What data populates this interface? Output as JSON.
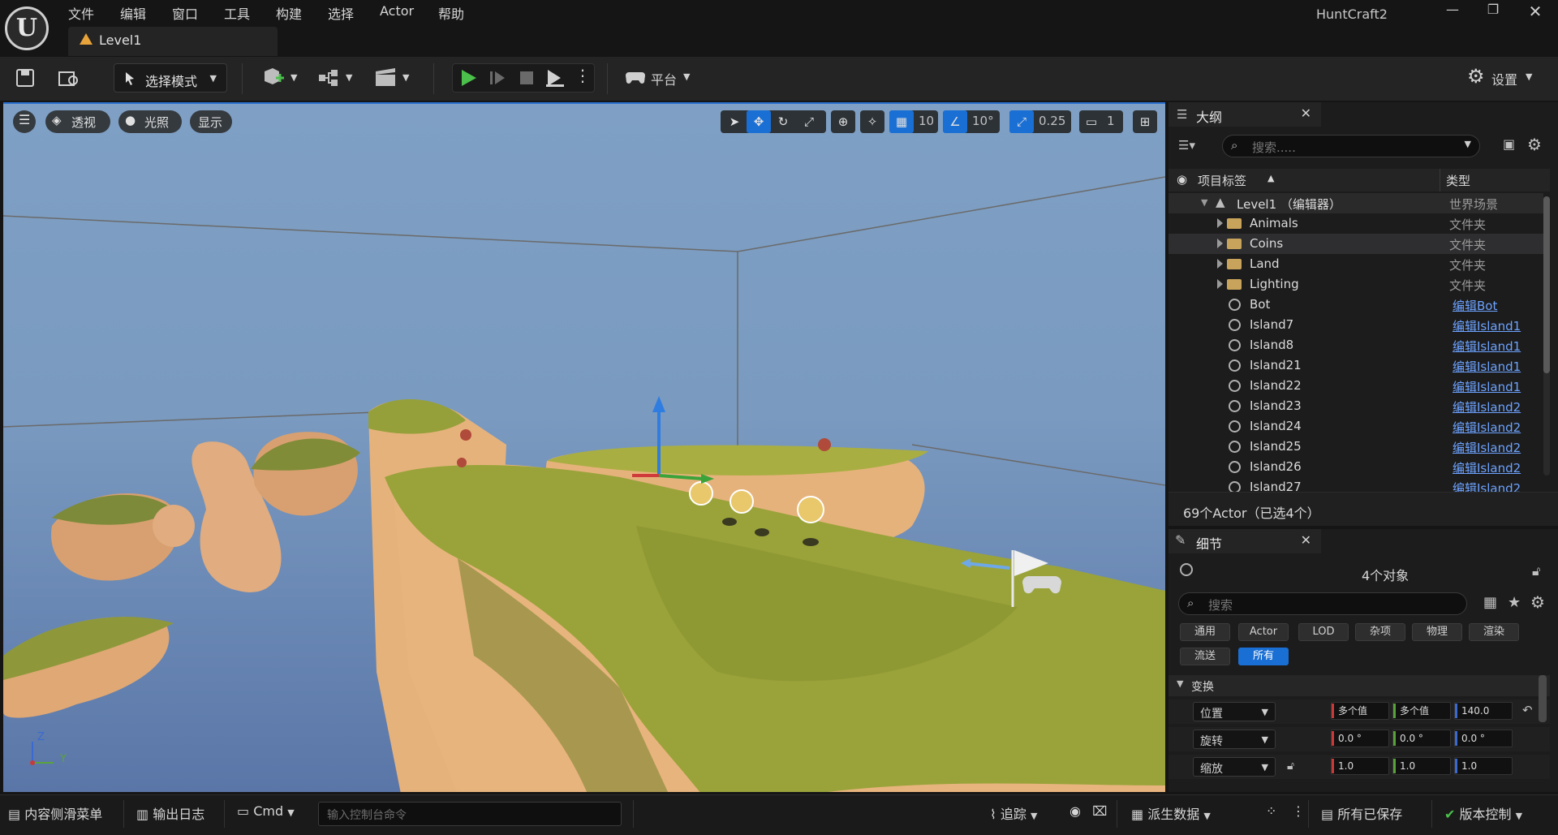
{
  "app": {
    "title": "HuntCraft2",
    "menu": [
      "文件",
      "编辑",
      "窗口",
      "工具",
      "构建",
      "选择",
      "Actor",
      "帮助"
    ],
    "level_tab": "Level1"
  },
  "toolbar": {
    "mode_select": "选择模式",
    "platform": "平台",
    "settings": "设置"
  },
  "viewport": {
    "perspective": "透视",
    "lighting": "光照",
    "show": "显示",
    "grid_snap": "10",
    "rot_snap": "10°",
    "scale_snap": "0.25",
    "camera_speed": "1",
    "axis_z": "Z",
    "axis_y": "Y"
  },
  "outliner": {
    "tab": "大纲",
    "search_placeholder": "搜索.....",
    "col_label": "项目标签",
    "col_type": "类型",
    "root": {
      "name": "Level1 （编辑器）",
      "type": "世界场景"
    },
    "folders": [
      {
        "name": "Animals",
        "type": "文件夹"
      },
      {
        "name": "Coins",
        "type": "文件夹"
      },
      {
        "name": "Land",
        "type": "文件夹"
      },
      {
        "name": "Lighting",
        "type": "文件夹"
      }
    ],
    "actors": [
      {
        "name": "Bot",
        "type": "编辑Bot"
      },
      {
        "name": "Island7",
        "type": "编辑Island1"
      },
      {
        "name": "Island8",
        "type": "编辑Island1"
      },
      {
        "name": "Island21",
        "type": "编辑Island1"
      },
      {
        "name": "Island22",
        "type": "编辑Island1"
      },
      {
        "name": "Island23",
        "type": "编辑Island2"
      },
      {
        "name": "Island24",
        "type": "编辑Island2"
      },
      {
        "name": "Island25",
        "type": "编辑Island2"
      },
      {
        "name": "Island26",
        "type": "编辑Island2"
      },
      {
        "name": "Island27",
        "type": "编辑Island2"
      }
    ],
    "status": "69个Actor（已选4个）"
  },
  "details": {
    "tab": "细节",
    "objects": "4个对象",
    "search_placeholder": "搜索",
    "filters": [
      "通用",
      "Actor",
      "LOD",
      "杂项",
      "物理",
      "渲染",
      "流送",
      "所有"
    ],
    "section": "变换",
    "location": {
      "label": "位置",
      "x": "多个值",
      "y": "多个值",
      "z": "140.0"
    },
    "rotation": {
      "label": "旋转",
      "x": "0.0 °",
      "y": "0.0 °",
      "z": "0.0 °"
    },
    "scale": {
      "label": "缩放",
      "x": "1.0",
      "y": "1.0",
      "z": "1.0"
    }
  },
  "statusbar": {
    "content_drawer": "内容侧滑菜单",
    "output_log": "输出日志",
    "cmd": "Cmd",
    "cmd_placeholder": "输入控制台命令",
    "trace": "追踪",
    "derived_data": "派生数据",
    "all_saved": "所有已保存",
    "source_control": "版本控制"
  },
  "colors": {
    "accent": "#1a6fd4",
    "link": "#6da3ff",
    "sky": "#7a9cc4",
    "grass": "#9aa43a",
    "rock": "#e8b47a"
  }
}
